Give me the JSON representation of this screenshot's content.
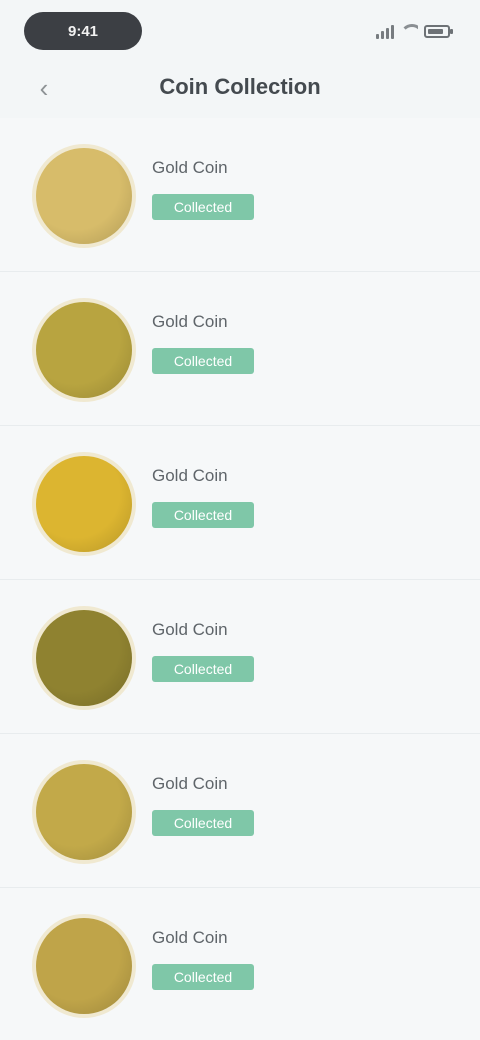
{
  "status_bar": {
    "time": "9:41"
  },
  "nav": {
    "title": "Coin Collection"
  },
  "items": [
    {
      "name": "Gold Coin",
      "badge": "Collected",
      "color": "#d7bc6a"
    },
    {
      "name": "Gold Coin",
      "badge": "Collected",
      "color": "#b8a440"
    },
    {
      "name": "Gold Coin",
      "badge": "Collected",
      "color": "#dcb530"
    },
    {
      "name": "Gold Coin",
      "badge": "Collected",
      "color": "#8f8230"
    },
    {
      "name": "Gold Coin",
      "badge": "Collected",
      "color": "#c2a949"
    },
    {
      "name": "Gold Coin",
      "badge": "Collected",
      "color": "#bfa449"
    }
  ]
}
